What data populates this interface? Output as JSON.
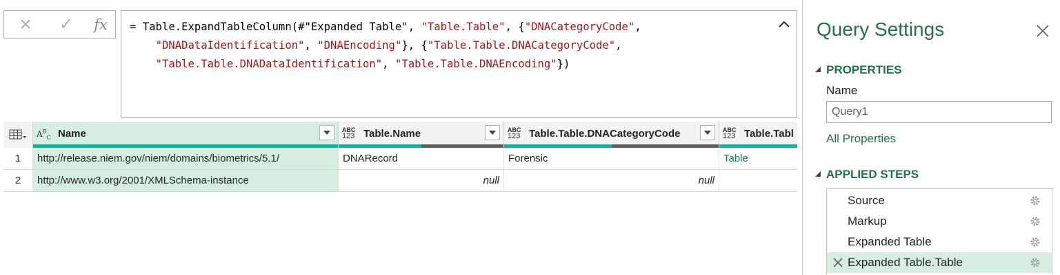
{
  "formula_bar": {
    "cancel_icon": "×",
    "commit_icon": "✓",
    "fx_label": "fx",
    "line1_a": "= Table.ExpandTableColumn(#\"Expanded Table\", ",
    "line1_b": "\"Table.Table\"",
    "line1_c": ", {",
    "line1_d": "\"DNACategoryCode\"",
    "line1_e": ",",
    "line2_a": "    ",
    "line2_b": "\"DNADataIdentification\"",
    "line2_c": ", ",
    "line2_d": "\"DNAEncoding\"",
    "line2_e": "}, {",
    "line2_f": "\"Table.Table.DNACategoryCode\"",
    "line2_g": ",",
    "line3_a": "    ",
    "line3_b": "\"Table.Table.DNADataIdentification\"",
    "line3_c": ", ",
    "line3_d": "\"Table.Table.DNAEncoding\"",
    "line3_e": "})"
  },
  "grid": {
    "columns": [
      {
        "type_top": "A",
        "type_bottom": "B C",
        "name": "Name",
        "quality": 1.0,
        "selected": true
      },
      {
        "type_top": "ABC",
        "type_bottom": "123",
        "name": "Table.Name",
        "quality": 0.5,
        "selected": false
      },
      {
        "type_top": "ABC",
        "type_bottom": "123",
        "name": "Table.Table.DNACategoryCode",
        "quality": 0.5,
        "selected": false
      },
      {
        "type_top": "ABC",
        "type_bottom": "123",
        "name": "Table.Tabl",
        "quality": 1.0,
        "selected": false
      }
    ],
    "rows": [
      {
        "num": "1",
        "name": "http://release.niem.gov/niem/domains/biometrics/5.1/",
        "table_name": "DNARecord",
        "category": "Forensic",
        "table": "Table"
      },
      {
        "num": "2",
        "name": "http://www.w3.org/2001/XMLSchema-instance",
        "table_name": "null",
        "category": "null",
        "table": ""
      }
    ]
  },
  "pane": {
    "title": "Query Settings",
    "properties_heading": "PROPERTIES",
    "name_label": "Name",
    "name_value": "Query1",
    "all_properties": "All Properties",
    "applied_steps_heading": "APPLIED STEPS",
    "steps": [
      {
        "label": "Source",
        "active": false
      },
      {
        "label": "Markup",
        "active": false
      },
      {
        "label": "Expanded Table",
        "active": false
      },
      {
        "label": "Expanded Table.Table",
        "active": true
      }
    ]
  },
  "colors": {
    "accent_green": "#217346",
    "selection_green": "#d5eedf",
    "quality_teal": "#0fb39f",
    "string_red": "#a31515"
  }
}
